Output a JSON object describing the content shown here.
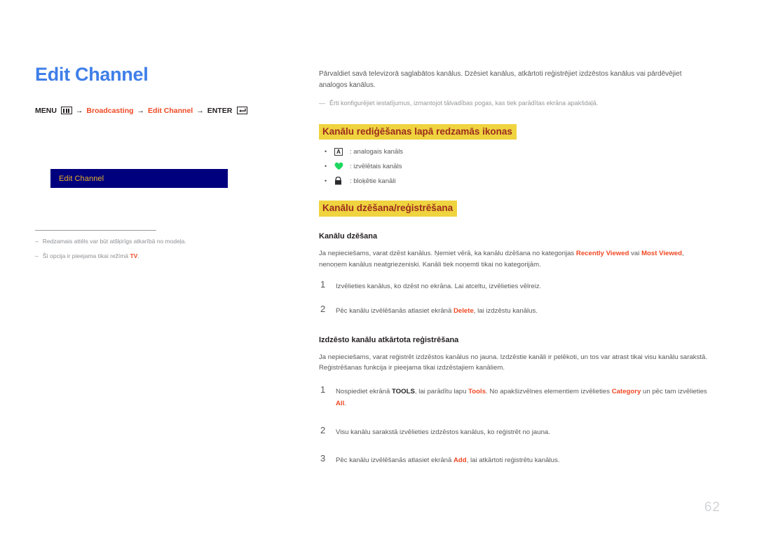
{
  "document": {
    "page_number": "62",
    "title": "Edit Channel"
  },
  "breadcrumb": {
    "menu_label": "MENU",
    "menu_icon": "menu-bars-icon",
    "arrow": "→",
    "item1": "Broadcasting",
    "item2": "Edit Channel",
    "enter_label": "ENTER",
    "enter_icon": "enter-return-icon"
  },
  "screenshot": {
    "menu_bar_label": "Edit Channel"
  },
  "footnotes": [
    {
      "dash": "‒",
      "text": "Redzamais attēls var būt atšķirīgs atkarībā no modeļa."
    },
    {
      "dash": "‒",
      "text_before": "Šī opcija ir pieejama tikai režīmā ",
      "tag": "TV",
      "text_after": "."
    }
  ],
  "right": {
    "intro": "Pārvaldiet savā televizorā saglabātos kanālus. Dzēsiet kanālus, atkārtoti reģistrējiet izdzēstos kanālus vai pārdēvējiet analogos kanālus.",
    "note_dash": "—",
    "note": "Ērti konfigurējiet iestatījumus, izmantojot tālvadības pogas, kas tiek parādītas ekrāna apakšdaļā.",
    "heading_icons": "Kanālu rediģēšanas lapā redzamās ikonas",
    "icon_bullets": [
      {
        "bullet": "•",
        "icon": "analog-channel-icon",
        "glyph": "A",
        "text": ": analogais kanāls"
      },
      {
        "bullet": "•",
        "icon": "favorite-heart-icon",
        "glyph": "♥",
        "text": ": izvēlētais kanāls"
      },
      {
        "bullet": "•",
        "icon": "locked-padlock-icon",
        "glyph": "🔒",
        "text": ": bloķētie kanāli"
      }
    ],
    "heading_delete_register": "Kanālu dzēšana/reģistrēšana",
    "section_delete": {
      "title": "Kanālu dzēšana",
      "para_p1": "Ja nepieciešams, varat dzēst kanālus. Ņemiet vērā, ka kanālu dzēšana no kategorijas ",
      "para_b1": "Recently Viewed",
      "para_p2": " vai ",
      "para_b2": "Most Viewed",
      "para_p3": ", nenoņem kanālus neatgriezeniski. Kanāli tiek noņemti tikai no kategorijām.",
      "steps": [
        {
          "num": "1",
          "p1": "Izvēlieties kanālus, ko dzēst no ekrāna. Lai atceltu, izvēlieties vēlreiz.",
          "b1": "",
          "p2": ""
        },
        {
          "num": "2",
          "p1": "Pēc kanālu izvēlēšanās atlasiet ekrānā ",
          "b1": "Delete",
          "p2": ", lai izdzēstu kanālus."
        }
      ]
    },
    "section_register": {
      "title": "Izdzēsto kanālu atkārtota reģistrēšana",
      "para": "Ja nepieciešams, varat reģistrēt izdzēstos kanālus no jauna. Izdzēstie kanāli ir pelēkoti, un tos var atrast tikai visu kanālu sarakstā. Reģistrēšanas funkcija ir pieejama tikai izdzēstajiem kanāliem.",
      "step1": {
        "num": "1",
        "p1": "Nospiediet ekrānā ",
        "b_tools_key": "TOOLS",
        "p2": ", lai parādītu lapu ",
        "b_tools": "Tools",
        "p3": ". No apakšizvēlnes elementiem izvēlieties ",
        "b_category": "Category",
        "p4": " un pēc tam izvēlieties ",
        "b_all": "All",
        "p5": "."
      },
      "step2": {
        "num": "2",
        "p1": "Visu kanālu sarakstā izvēlieties izdzēstos kanālus, ko reģistrēt no jauna."
      },
      "step3": {
        "num": "3",
        "p1": "Pēc kanālu izvēlēšanās atlasiet ekrānā ",
        "b1": "Add",
        "p2": ", lai atkārtoti reģistrētu kanālus."
      }
    }
  },
  "colors": {
    "title_blue": "#3f7fe8",
    "accent_red": "#ef4823",
    "highlight_yellow": "#efd33f",
    "heading_maroon": "#9c2b1e",
    "tv_navy": "#00007e",
    "tv_gold": "#e8b226",
    "body_gray": "#58585a"
  }
}
